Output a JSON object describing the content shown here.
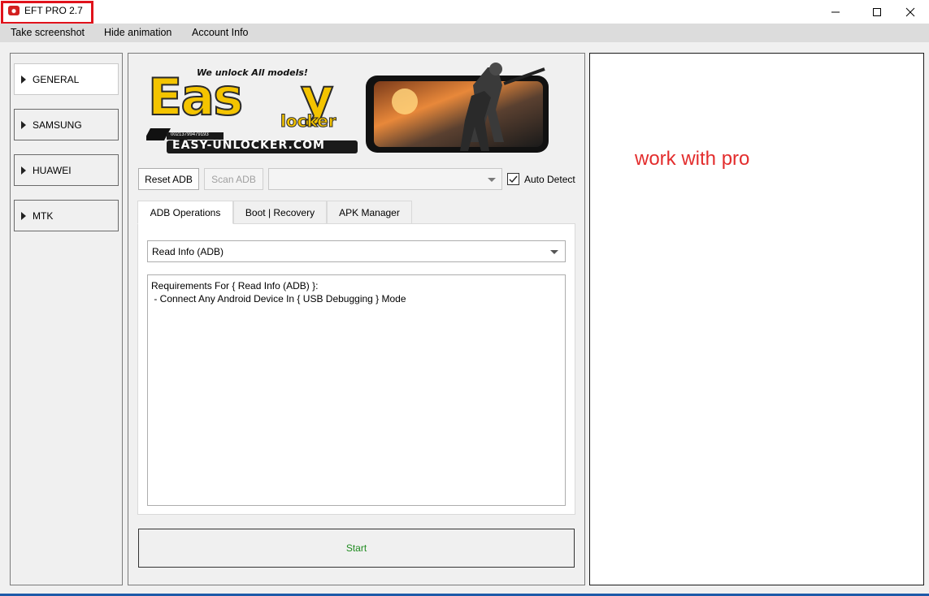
{
  "window": {
    "title": "EFT PRO 2.7",
    "highlight_color": "#e0121b"
  },
  "menu": {
    "items": [
      "Take screenshot",
      "Hide animation",
      "Account Info"
    ]
  },
  "sidebar": {
    "items": [
      {
        "label": "GENERAL",
        "active": true
      },
      {
        "label": "SAMSUNG",
        "active": false
      },
      {
        "label": "HUAWEI",
        "active": false
      },
      {
        "label": "MTK",
        "active": false
      }
    ]
  },
  "banner": {
    "tagline": "We unlock All models!",
    "logo_main": "Eas",
    "logo_y": "y",
    "logo_sub": "locker",
    "url": "EASY-UNLOCKER.COM",
    "phone": "00213799479193",
    "accent_color": "#f4c400"
  },
  "controls": {
    "reset_label": "Reset ADB",
    "scan_label": "Scan ADB",
    "port_value": "",
    "auto_detect_label": "Auto Detect",
    "auto_detect_checked": true
  },
  "tabs": [
    {
      "label": "ADB Operations",
      "active": true
    },
    {
      "label": "Boot | Recovery",
      "active": false
    },
    {
      "label": "APK Manager",
      "active": false
    }
  ],
  "operation": {
    "selected": "Read Info (ADB)"
  },
  "info": {
    "lines": [
      "Requirements For { Read Info (ADB) }:",
      " - Connect Any Android Device In { USB Debugging } Mode"
    ]
  },
  "start": {
    "label": "Start",
    "color": "#1f8b1f"
  },
  "right_panel": {
    "text": "work with pro",
    "color": "#e32d2d"
  },
  "icons": {
    "app": "app-logo-icon",
    "minimize": "minimize-icon",
    "maximize": "maximize-icon",
    "close": "close-icon",
    "dropdown": "chevron-down-icon",
    "check": "checkmark-icon",
    "nav": "triangle-right-icon"
  }
}
